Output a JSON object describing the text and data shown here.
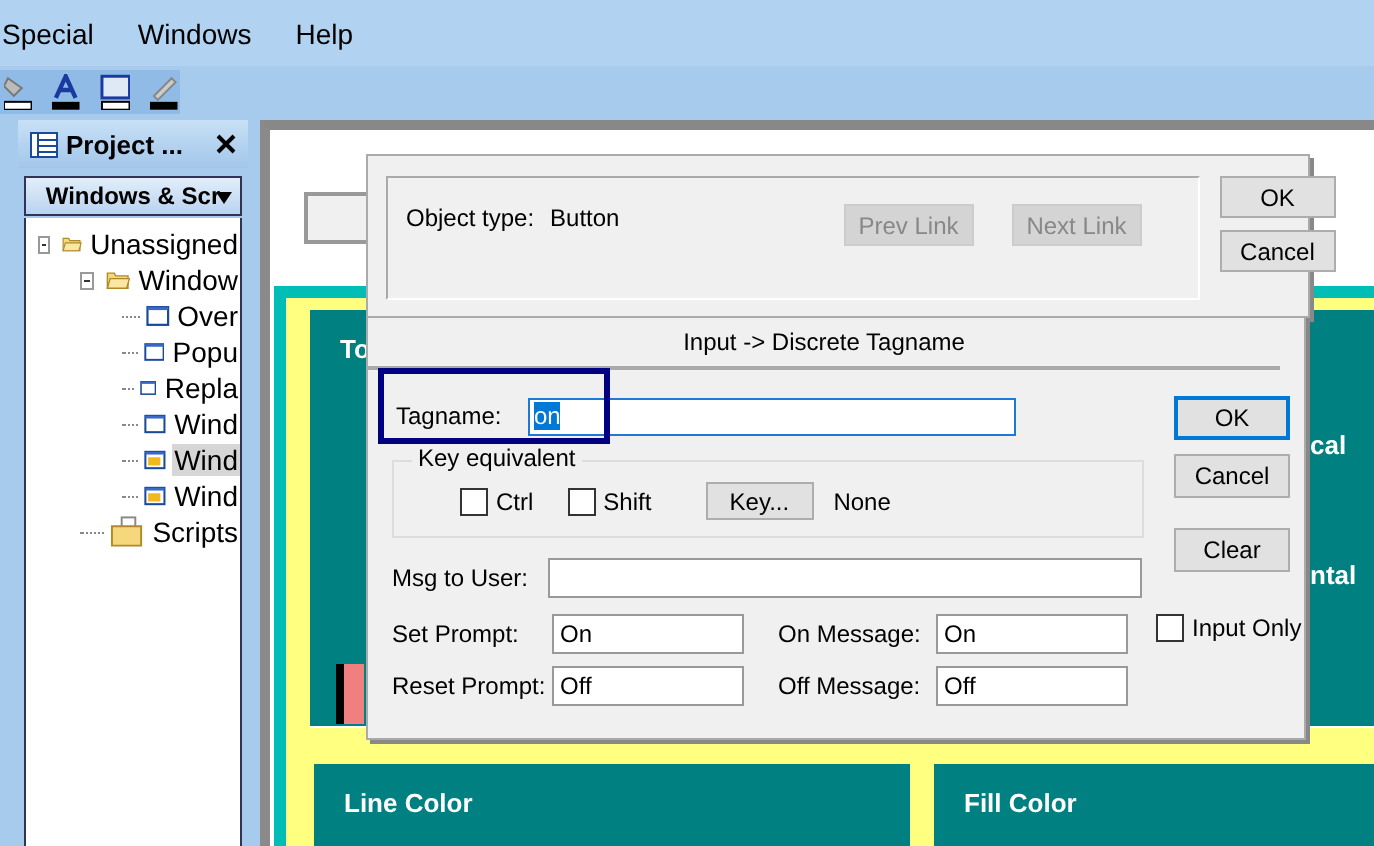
{
  "menu": [
    {
      "label": "Special"
    },
    {
      "label": "Windows"
    },
    {
      "label": "Help"
    }
  ],
  "project_panel": {
    "title": "Project ...",
    "tab": "Windows & Scr",
    "tree": [
      {
        "label": "Unassigned",
        "kind": "folder",
        "expanded": true,
        "selected": false,
        "children": [
          {
            "label": "Window",
            "kind": "folder",
            "expanded": true,
            "selected": false,
            "children": [
              {
                "label": "Over",
                "kind": "window",
                "selected": false
              },
              {
                "label": "Popu",
                "kind": "window",
                "selected": false
              },
              {
                "label": "Repla",
                "kind": "window",
                "selected": false
              },
              {
                "label": "Wind",
                "kind": "window",
                "selected": false
              },
              {
                "label": "Wind",
                "kind": "popup-window",
                "selected": true
              },
              {
                "label": "Wind",
                "kind": "popup-window",
                "selected": false
              }
            ]
          },
          {
            "label": "Scripts",
            "kind": "scripts",
            "selected": false
          }
        ]
      }
    ]
  },
  "canvas": {
    "panels": [
      {
        "title": "To"
      },
      {
        "title": "Line Color"
      },
      {
        "title": "Fill Color"
      }
    ],
    "side_texts": [
      "cal",
      "ntal"
    ]
  },
  "object_dialog": {
    "label": "Object type:",
    "value": "Button",
    "links": [
      {
        "label": "Prev Link",
        "disabled": true
      },
      {
        "label": "Next Link",
        "disabled": true
      }
    ],
    "buttons": [
      {
        "label": "OK"
      },
      {
        "label": "Cancel"
      }
    ]
  },
  "tag_dialog": {
    "title": "Input -> Discrete Tagname",
    "tagname": {
      "label": "Tagname:",
      "value": "on",
      "highlighted": true
    },
    "key_equivalent": {
      "label": "Key equivalent",
      "checkboxes": [
        {
          "label": "Ctrl",
          "checked": false
        },
        {
          "label": "Shift",
          "checked": false
        }
      ],
      "key_button": "Key...",
      "key_value": "None"
    },
    "msg_to_user": {
      "label": "Msg to User:"
    },
    "fields": [
      {
        "label": "Set Prompt:",
        "value": "On"
      },
      {
        "label": "On Message:",
        "value": "On"
      },
      {
        "label": "Reset Prompt:",
        "value": "Off"
      },
      {
        "label": "Off Message:",
        "value": "Off"
      }
    ],
    "input_only": {
      "label": "Input Only",
      "checked": false
    },
    "buttons": [
      {
        "label": "OK",
        "focused": true
      },
      {
        "label": "Cancel",
        "focused": false
      },
      {
        "label": "Clear",
        "focused": false
      }
    ]
  }
}
